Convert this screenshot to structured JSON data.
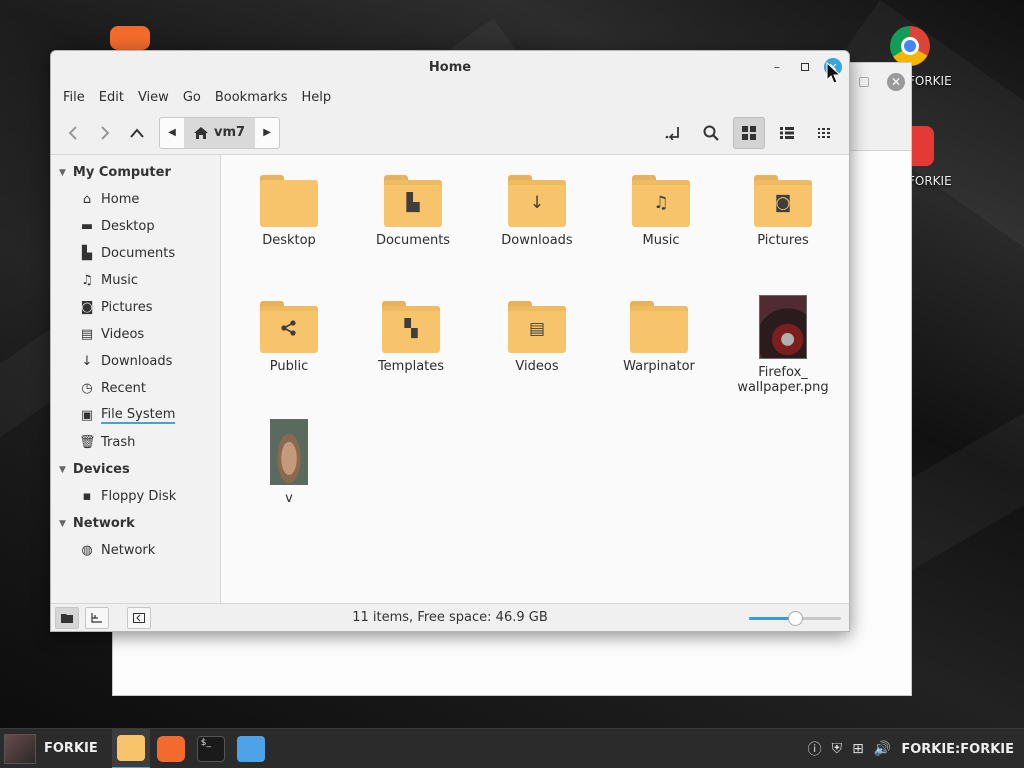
{
  "desktop": {
    "labels": [
      {
        "text": "FORKIE"
      },
      {
        "text": "FORKIE"
      }
    ]
  },
  "window": {
    "title": "Home",
    "menu": [
      "File",
      "Edit",
      "View",
      "Go",
      "Bookmarks",
      "Help"
    ],
    "breadcrumb": {
      "segment": "vm7"
    },
    "status": "11 items, Free space: 46.9 GB",
    "zoom_level": 0.5
  },
  "sidebar": {
    "sections": [
      {
        "title": "My Computer",
        "items": [
          {
            "label": "Home",
            "icon": "home-icon"
          },
          {
            "label": "Desktop",
            "icon": "desktop-icon"
          },
          {
            "label": "Documents",
            "icon": "document-icon"
          },
          {
            "label": "Music",
            "icon": "music-icon"
          },
          {
            "label": "Pictures",
            "icon": "camera-icon"
          },
          {
            "label": "Videos",
            "icon": "film-icon"
          },
          {
            "label": "Downloads",
            "icon": "download-icon"
          },
          {
            "label": "Recent",
            "icon": "clock-icon"
          },
          {
            "label": "File System",
            "icon": "drive-icon"
          },
          {
            "label": "Trash",
            "icon": "trash-icon"
          }
        ]
      },
      {
        "title": "Devices",
        "items": [
          {
            "label": "Floppy Disk",
            "icon": "floppy-icon"
          }
        ]
      },
      {
        "title": "Network",
        "items": [
          {
            "label": "Network",
            "icon": "globe-icon"
          }
        ]
      }
    ]
  },
  "files": [
    {
      "name": "Desktop",
      "kind": "folder",
      "emblem": ""
    },
    {
      "name": "Documents",
      "kind": "folder",
      "emblem": "document-icon"
    },
    {
      "name": "Downloads",
      "kind": "folder",
      "emblem": "download-icon"
    },
    {
      "name": "Music",
      "kind": "folder",
      "emblem": "music-icon"
    },
    {
      "name": "Pictures",
      "kind": "folder",
      "emblem": "camera-icon"
    },
    {
      "name": "Public",
      "kind": "folder",
      "emblem": "share-icon"
    },
    {
      "name": "Templates",
      "kind": "folder",
      "emblem": "template-icon"
    },
    {
      "name": "Videos",
      "kind": "folder",
      "emblem": "film-icon"
    },
    {
      "name": "Warpinator",
      "kind": "folder",
      "emblem": ""
    },
    {
      "name": "Firefox_\nwallpaper.png",
      "kind": "image",
      "emblem": ""
    },
    {
      "name": "v",
      "kind": "image",
      "emblem": ""
    }
  ],
  "taskbar": {
    "start_label": "FORKIE",
    "user_label": "FORKIE:FORKIE"
  },
  "colors": {
    "accent": "#3d9bdc",
    "folder": "#f7c46c",
    "folder_dark": "#e8b25c",
    "panel": "#2b2b2b"
  }
}
